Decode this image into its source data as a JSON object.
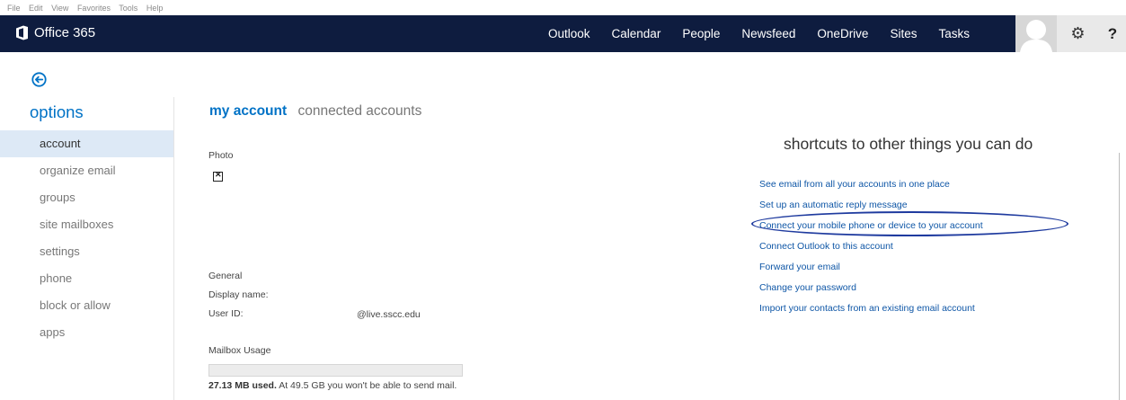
{
  "menu": [
    "File",
    "Edit",
    "View",
    "Favorites",
    "Tools",
    "Help"
  ],
  "brand": {
    "name": "Office 365"
  },
  "nav": [
    "Outlook",
    "Calendar",
    "People",
    "Newsfeed",
    "OneDrive",
    "Sites",
    "Tasks"
  ],
  "help_label": "?",
  "sidebar": {
    "title": "options",
    "items": [
      {
        "label": "account"
      },
      {
        "label": "organize email"
      },
      {
        "label": "groups"
      },
      {
        "label": "site mailboxes"
      },
      {
        "label": "settings"
      },
      {
        "label": "phone"
      },
      {
        "label": "block or allow"
      },
      {
        "label": "apps"
      }
    ]
  },
  "tabs": {
    "active": "my account",
    "other": "connected accounts"
  },
  "account": {
    "photo_label": "Photo",
    "general_label": "General",
    "display_name_label": "Display name:",
    "user_id_label": "User ID:",
    "user_id_value": "@live.sscc.edu",
    "mailbox_usage_label": "Mailbox Usage",
    "usage_used": "27.13 MB used.",
    "usage_note": " At 49.5 GB you won't be able to send mail."
  },
  "shortcuts": {
    "title": "shortcuts to other things you can do",
    "links": [
      "See email from all your accounts in one place",
      "Set up an automatic reply message",
      "Connect your mobile phone or device to your account",
      "Connect Outlook to this account",
      "Forward your email",
      "Change your password",
      "Import your contacts from an existing email account"
    ]
  },
  "colors": {
    "topbar": "#0e1c3f",
    "accent": "#0072c6",
    "link": "#0e56a6",
    "highlight_ellipse": "#1f3b9f"
  }
}
